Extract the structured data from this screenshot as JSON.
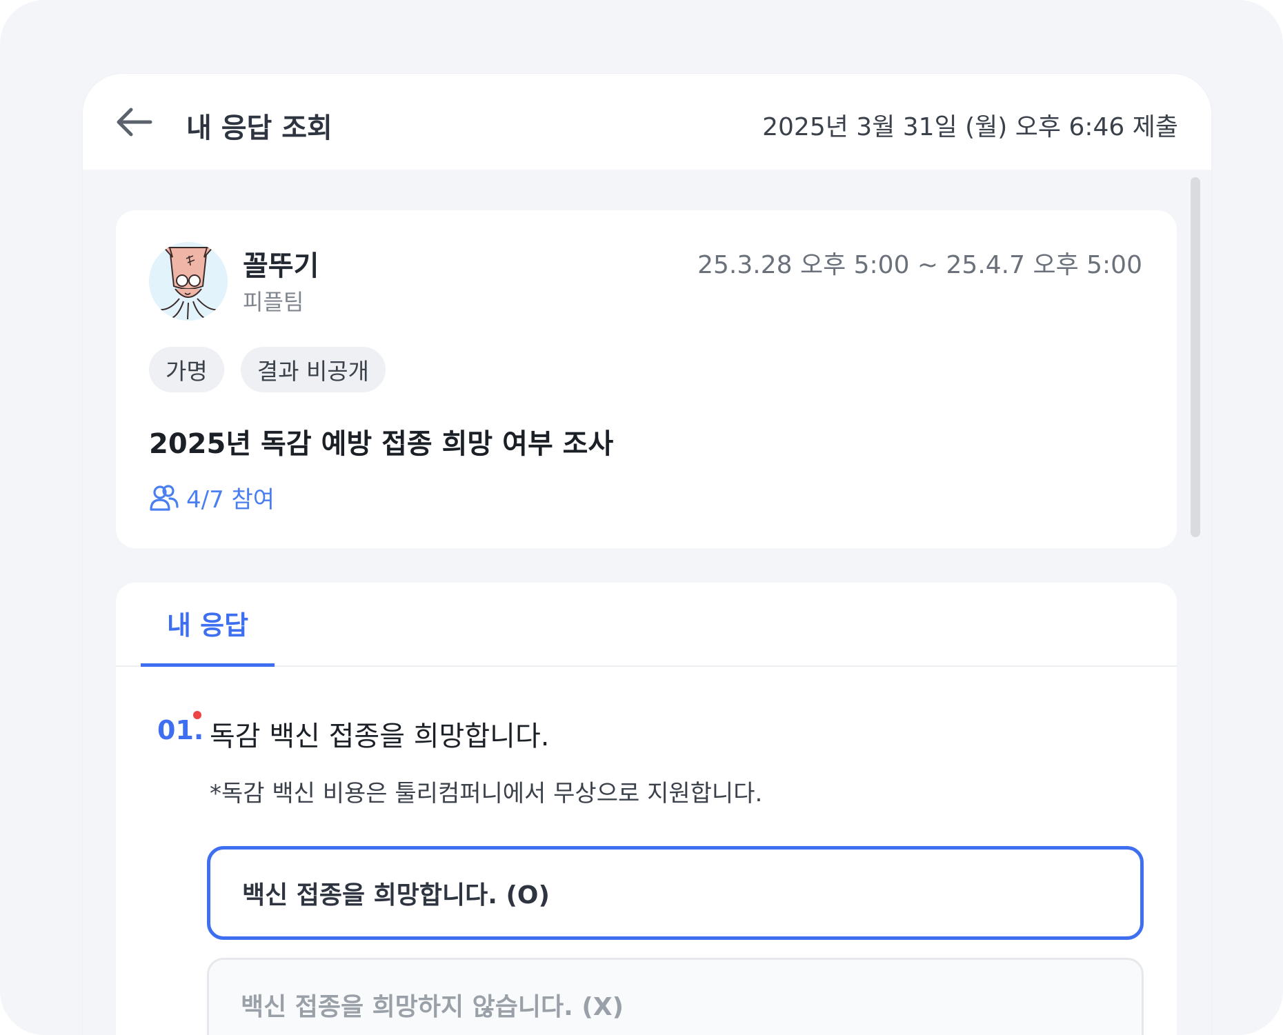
{
  "header": {
    "title": "내 응답 조회",
    "submitted_at": "2025년 3월 31일 (월) 오후 6:46 제출"
  },
  "survey": {
    "author_name": "꼴뚜기",
    "author_team": "피플팀",
    "period": "25.3.28 오후 5:00 ~ 25.4.7 오후 5:00",
    "tags": [
      "가명",
      "결과 비공개"
    ],
    "title": "2025년 독감 예방 접종 희망 여부 조사",
    "participation": "4/7 참여"
  },
  "tabs": {
    "active_label": "내 응답"
  },
  "question": {
    "number": "01.",
    "required": true,
    "text": "독감 백신 접종을 희망합니다.",
    "description": "*독감 백신 비용은 툴리컴퍼니에서 무상으로 지원합니다.",
    "options": [
      {
        "label": "백신 접종을 희망합니다. (O)",
        "selected": true
      },
      {
        "label": "백신 접종을 희망하지 않습니다. (X)",
        "selected": false
      }
    ]
  },
  "colors": {
    "accent": "#3d6ff0",
    "required_dot": "#ef4444",
    "background": "#f4f5f8"
  },
  "icons": {
    "back": "arrow-left-icon",
    "participants": "users-icon"
  }
}
